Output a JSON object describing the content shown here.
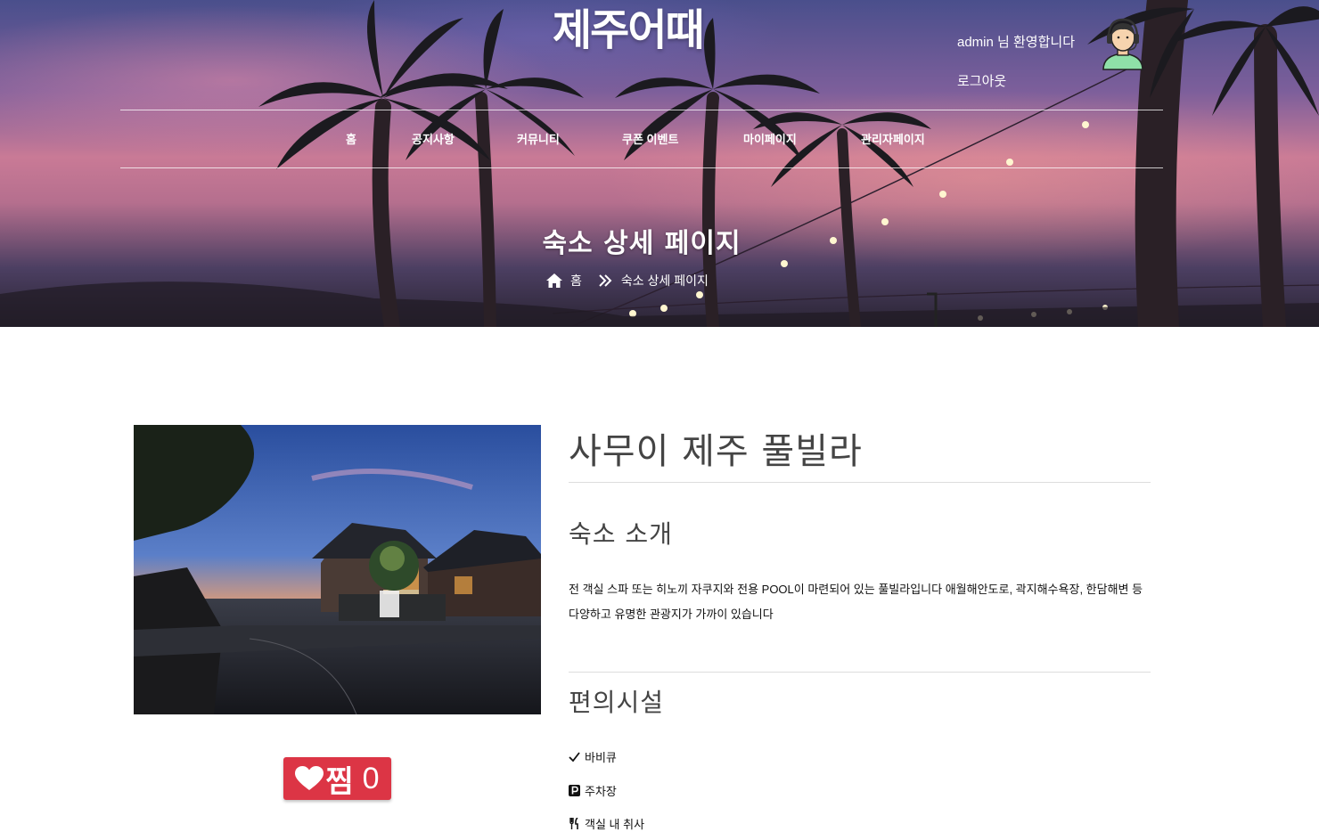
{
  "header": {
    "brand": "제주어때",
    "welcome": "admin 님 환영합니다",
    "logout": "로그아웃",
    "avatar_icon": "headset-user-avatar"
  },
  "nav": {
    "items": [
      {
        "label": "홈"
      },
      {
        "label": "공지사항"
      },
      {
        "label": "커뮤니티"
      },
      {
        "label": "쿠폰 이벤트"
      },
      {
        "label": "마이페이지"
      },
      {
        "label": "관리자페이지"
      }
    ]
  },
  "hero": {
    "title": "숙소 상세 페이지",
    "breadcrumb": {
      "home": "홈",
      "current": "숙소 상세 페이지",
      "home_icon": "home-icon",
      "separator_icon": "double-chevron-right-icon"
    }
  },
  "accommodation": {
    "name": "사무이 제주 풀빌라",
    "intro_title": "숙소 소개",
    "intro_text": "전 객실 스파 또는 히노끼 자쿠지와 전용 POOL이 마련되어 있는 풀빌라입니다 애월해안도로, 곽지해수욕장, 한담해변 등 다양하고 유명한 관광지가 가까이 있습니다",
    "amenities_title": "편의시설",
    "amenities": [
      {
        "icon": "check-icon",
        "label": "바비큐"
      },
      {
        "icon": "parking-icon",
        "label": "주차장"
      },
      {
        "icon": "utensils-icon",
        "label": "객실 내 취사"
      }
    ],
    "like": {
      "label": "찜",
      "count": "0",
      "icon": "heart-icon",
      "color": "#dc3545"
    }
  }
}
